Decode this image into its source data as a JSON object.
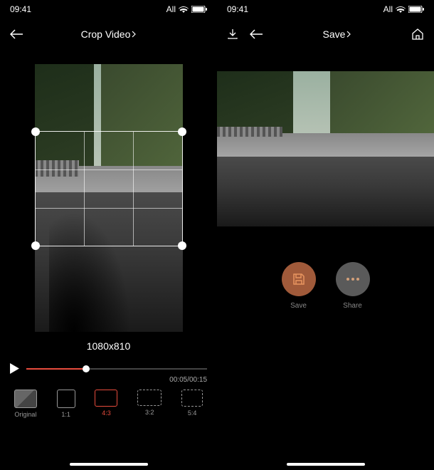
{
  "status": {
    "time": "09:41",
    "carrier": "All"
  },
  "left": {
    "title": "Crop Video",
    "dimensions": "1080x810",
    "time_display": "00:05/00:15",
    "ratios": [
      {
        "label": "Original"
      },
      {
        "label": "1:1"
      },
      {
        "label": "4:3"
      },
      {
        "label": "3:2"
      },
      {
        "label": "5:4"
      }
    ]
  },
  "right": {
    "title": "Save",
    "actions": {
      "save_label": "Save",
      "share_label": "Share"
    }
  }
}
